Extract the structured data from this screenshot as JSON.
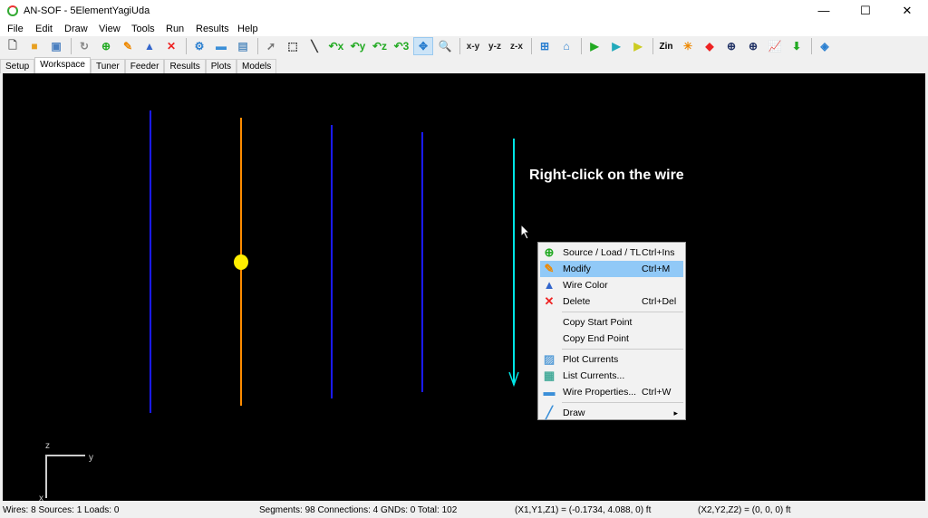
{
  "window": {
    "title": "AN-SOF - 5ElementYagiUda",
    "minimize": "—",
    "maximize": "☐",
    "close": "✕"
  },
  "menubar": [
    "File",
    "Edit",
    "Draw",
    "View",
    "Tools",
    "Run",
    "Results",
    "Help"
  ],
  "toolbar": [
    {
      "icon": "new-file-icon",
      "g": "🗋",
      "c": "#555"
    },
    {
      "icon": "open-folder-icon",
      "g": "■",
      "c": "#e8a020"
    },
    {
      "icon": "save-icon",
      "g": "▣",
      "c": "#4a7fc0"
    },
    "|",
    {
      "icon": "refresh-icon",
      "g": "↻",
      "c": "#888"
    },
    {
      "icon": "add-source-icon",
      "g": "⊕",
      "c": "#2a2"
    },
    {
      "icon": "pencil-icon",
      "g": "✎",
      "c": "#e80"
    },
    {
      "icon": "wire-color-icon",
      "g": "▲",
      "c": "#36c"
    },
    {
      "icon": "delete-icon",
      "g": "✕",
      "c": "#e22"
    },
    "|",
    {
      "icon": "settings-icon",
      "g": "⚙",
      "c": "#2a7fd0"
    },
    {
      "icon": "wire-properties-icon",
      "g": "▬",
      "c": "#3a8fd8"
    },
    {
      "icon": "report-icon",
      "g": "▤",
      "c": "#5a8fc0"
    },
    "|",
    {
      "icon": "pointer-icon",
      "g": "➚",
      "c": "#777"
    },
    {
      "icon": "select-rect-icon",
      "g": "⬚",
      "c": "#333"
    },
    {
      "icon": "line-icon",
      "g": "╲",
      "c": "#333"
    },
    {
      "icon": "rotate-x-icon",
      "g": "↶x",
      "c": "#2a2"
    },
    {
      "icon": "rotate-y-icon",
      "g": "↶y",
      "c": "#2a2"
    },
    {
      "icon": "rotate-z-icon",
      "g": "↶z",
      "c": "#2a2"
    },
    {
      "icon": "rotate-3d-icon",
      "g": "↶3",
      "c": "#2a2"
    },
    {
      "icon": "pan-icon",
      "g": "✥",
      "c": "#2a7fd0",
      "active": true
    },
    {
      "icon": "zoom-icon",
      "g": "🔍",
      "c": "#555"
    },
    "|",
    {
      "icon": "view-xy-icon",
      "g": "x-y",
      "c": "#222"
    },
    {
      "icon": "view-yz-icon",
      "g": "y-z",
      "c": "#222"
    },
    {
      "icon": "view-zx-icon",
      "g": "z-x",
      "c": "#222"
    },
    "|",
    {
      "icon": "fit-icon",
      "g": "⊞",
      "c": "#2a7fd0"
    },
    {
      "icon": "home-icon",
      "g": "⌂",
      "c": "#2a7fd0"
    },
    "|",
    {
      "icon": "run-icon",
      "g": "▶",
      "c": "#2a2"
    },
    {
      "icon": "run-alt-icon",
      "g": "▶",
      "c": "#2ab"
    },
    {
      "icon": "run-far-icon",
      "g": "▶",
      "c": "#cc2"
    },
    "|",
    {
      "icon": "zin-icon",
      "g": "Zin",
      "c": "#000"
    },
    {
      "icon": "pattern-icon",
      "g": "✳",
      "c": "#e80"
    },
    {
      "icon": "heatmap-icon",
      "g": "◆",
      "c": "#e22"
    },
    {
      "icon": "sphere-icon",
      "g": "⊕",
      "c": "#236"
    },
    {
      "icon": "sphere2-icon",
      "g": "⊕",
      "c": "#236"
    },
    {
      "icon": "chart-icon",
      "g": "📈",
      "c": "#a22"
    },
    {
      "icon": "download-icon",
      "g": "⬇",
      "c": "#2a2"
    },
    "|",
    {
      "icon": "help-book-icon",
      "g": "◈",
      "c": "#2a7fd0"
    }
  ],
  "tabs": [
    "Setup",
    "Workspace",
    "Tuner",
    "Feeder",
    "Results",
    "Plots",
    "Models"
  ],
  "active_tab": "Workspace",
  "canvas": {
    "hint": "Right-click on the wire",
    "axis": {
      "z": "z",
      "y": "y",
      "x": "x"
    }
  },
  "context_menu": [
    {
      "label": "Source / Load / TL",
      "shortcut": "Ctrl+Ins",
      "icon": "add-source-icon"
    },
    {
      "label": "Modify",
      "shortcut": "Ctrl+M",
      "icon": "pencil-icon",
      "highlighted": true
    },
    {
      "label": "Wire Color",
      "shortcut": "",
      "icon": "wire-color-icon"
    },
    {
      "label": "Delete",
      "shortcut": "Ctrl+Del",
      "icon": "delete-icon"
    },
    "-",
    {
      "label": "Copy Start Point",
      "shortcut": ""
    },
    {
      "label": "Copy End Point",
      "shortcut": ""
    },
    "-",
    {
      "label": "Plot Currents",
      "shortcut": "",
      "icon": "plot-icon"
    },
    {
      "label": "List Currents...",
      "shortcut": "",
      "icon": "table-icon"
    },
    {
      "label": "Wire Properties...",
      "shortcut": "Ctrl+W",
      "icon": "wire-properties-icon"
    },
    "-",
    {
      "label": "Draw",
      "shortcut": "",
      "icon": "brush-icon",
      "submenu": "▸"
    }
  ],
  "status": {
    "wires": "Wires: 8  Sources: 1  Loads: 0",
    "segments": "Segments: 98  Connections: 4  GNDs: 0  Total: 102",
    "p1": "(X1,Y1,Z1) = (-0.1734, 4.088, 0) ft",
    "p2": "(X2,Y2,Z2) = (0, 0, 0) ft"
  },
  "colors": {
    "reflector": "#1a1aff",
    "driven": "#ff8c00",
    "director": "#1a1aff",
    "selected": "#00e5e5",
    "source": "#ffee00"
  }
}
